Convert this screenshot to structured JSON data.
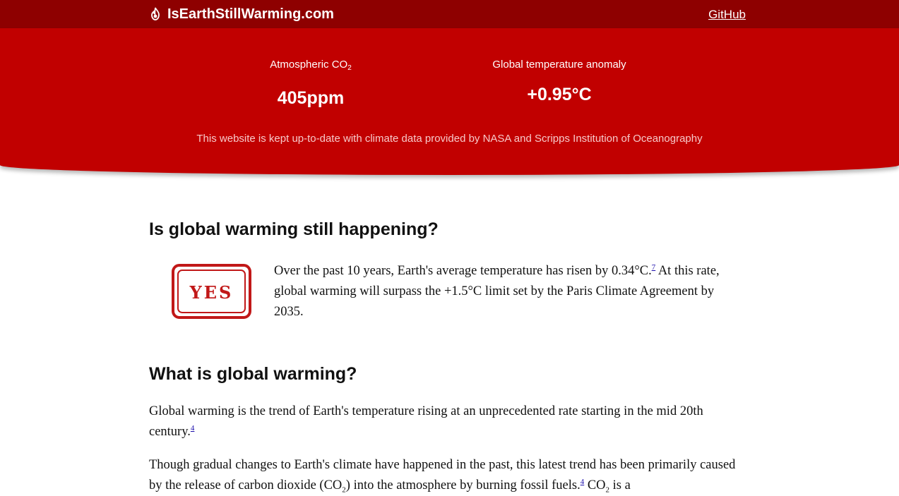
{
  "nav": {
    "site_name": "IsEarthStillWarming.com",
    "github_label": "GitHub"
  },
  "hero": {
    "co2_label": "Atmospheric CO",
    "co2_label_sub": "2",
    "co2_value": "405ppm",
    "temp_label": "Global temperature anomaly",
    "temp_value": "+0.95°C",
    "note": "This website is kept up-to-date with climate data provided by NASA and Scripps Institution of Oceanography"
  },
  "section_answer": {
    "heading": "Is global warming still happening?",
    "stamp_text": "YES",
    "text_1": "Over the past 10 years, Earth's average temperature has risen by 0.34°C.",
    "ref_1": "7",
    "text_2": " At this rate, global warming will surpass the +1.5°C limit set by the Paris Climate Agreement by 2035."
  },
  "section_what": {
    "heading": "What is global warming?",
    "para1_text": "Global warming is the trend of Earth's temperature rising at an unprecedented rate starting in the mid 20th century.",
    "para1_ref": "4",
    "para2_text_1": "Though gradual changes to Earth's climate have happened in the past, this latest trend has been primarily caused by the release of carbon dioxide (CO",
    "para2_sub_1": "2",
    "para2_text_2": ") into the atmosphere by burning fossil fuels.",
    "para2_ref": "4",
    "para2_text_3": " CO",
    "para2_sub_2": "2",
    "para2_text_4": " is a"
  },
  "colors": {
    "topbar": "#8e0000",
    "hero": "#c10000",
    "stamp": "#c11818"
  }
}
